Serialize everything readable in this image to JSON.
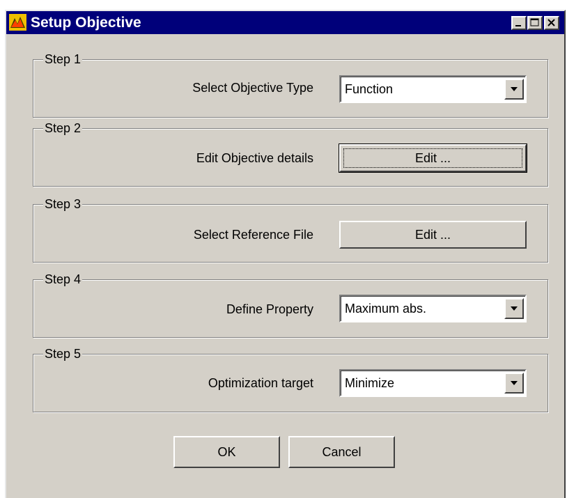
{
  "window": {
    "title": "Setup Objective",
    "controls": {
      "minimize": "minimize",
      "maximize": "maximize",
      "close": "close"
    }
  },
  "steps": [
    {
      "legend": "Step 1",
      "label": "Select Objective Type",
      "control": "dropdown",
      "value": "Function"
    },
    {
      "legend": "Step 2",
      "label": "Edit Objective details",
      "control": "button",
      "value": "Edit ..."
    },
    {
      "legend": "Step 3",
      "label": "Select Reference File",
      "control": "button",
      "value": "Edit ..."
    },
    {
      "legend": "Step 4",
      "label": "Define Property",
      "control": "dropdown",
      "value": "Maximum abs."
    },
    {
      "legend": "Step 5",
      "label": "Optimization target",
      "control": "dropdown",
      "value": "Minimize"
    }
  ],
  "buttons": {
    "ok": "OK",
    "cancel": "Cancel"
  },
  "icons": {
    "app": "app-icon",
    "dropdown": "chevron-down-icon"
  },
  "colors": {
    "titlebar": "#00007a",
    "face": "#d4d0c8"
  }
}
